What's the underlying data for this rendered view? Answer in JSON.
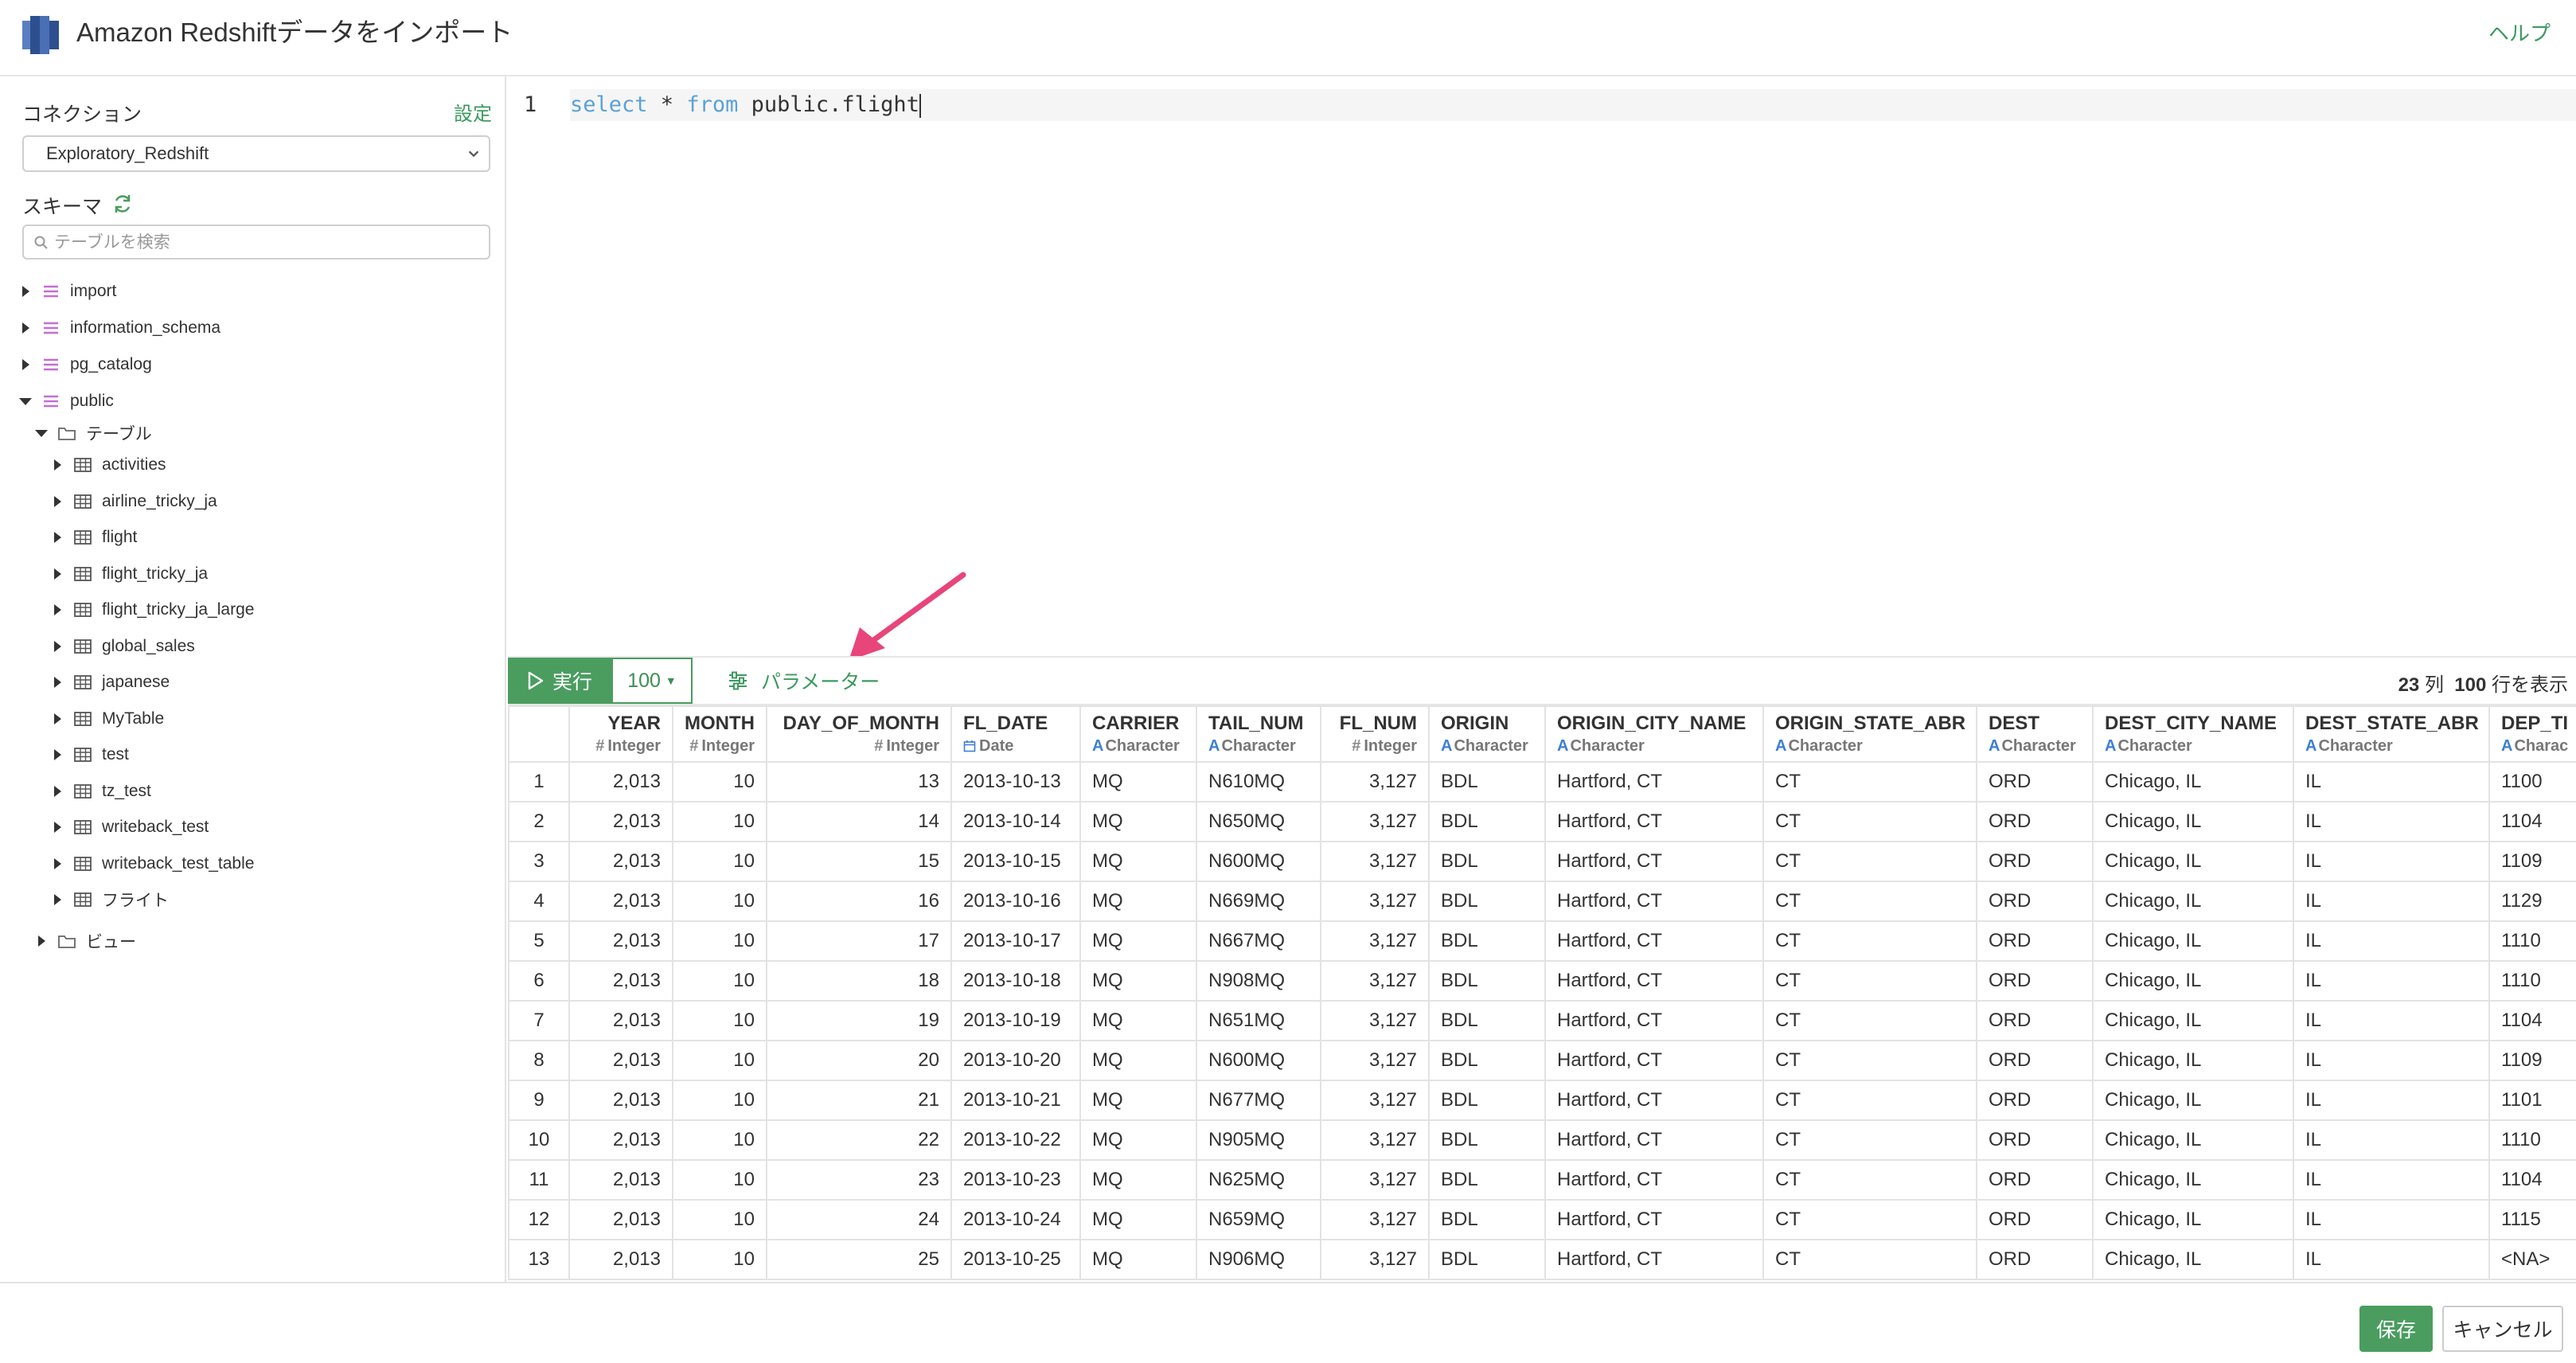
{
  "app": {
    "title": "Amazon Redshiftデータをインポート",
    "help_label": "ヘルプ"
  },
  "sidebar": {
    "connection_label": "コネクション",
    "settings_label": "設定",
    "connection_value": "Exploratory_Redshift",
    "schema_label": "スキーマ",
    "search_placeholder": "テーブルを検索",
    "schemas": [
      {
        "name": "import",
        "expanded": false
      },
      {
        "name": "information_schema",
        "expanded": false
      },
      {
        "name": "pg_catalog",
        "expanded": false
      },
      {
        "name": "public",
        "expanded": true
      }
    ],
    "tables_folder": "テーブル",
    "tables": [
      "activities",
      "airline_tricky_ja",
      "flight",
      "flight_tricky_ja",
      "flight_tricky_ja_large",
      "global_sales",
      "japanese",
      "MyTable",
      "test",
      "tz_test",
      "writeback_test",
      "writeback_test_table",
      "フライト"
    ],
    "views_folder": "ビュー"
  },
  "editor": {
    "line_number": "1",
    "tokens": [
      {
        "text": "select",
        "type": "kw"
      },
      {
        "text": " * ",
        "type": "plain"
      },
      {
        "text": "from",
        "type": "kw"
      },
      {
        "text": " public.flight",
        "type": "plain"
      }
    ]
  },
  "toolbar": {
    "run_label": "実行",
    "limit_value": "100",
    "params_label": "パラメーター",
    "col_count": "23",
    "col_suffix": "列",
    "row_count": "100",
    "row_suffix": "行を表示"
  },
  "table": {
    "columns": [
      {
        "name": "YEAR",
        "type": "Integer",
        "kind": "num",
        "align": "right"
      },
      {
        "name": "MONTH",
        "type": "Integer",
        "kind": "num",
        "align": "right"
      },
      {
        "name": "DAY_OF_MONTH",
        "type": "Integer",
        "kind": "num",
        "align": "right"
      },
      {
        "name": "FL_DATE",
        "type": "Date",
        "kind": "date",
        "align": "left"
      },
      {
        "name": "CARRIER",
        "type": "Character",
        "kind": "char",
        "align": "left"
      },
      {
        "name": "TAIL_NUM",
        "type": "Character",
        "kind": "char",
        "align": "left"
      },
      {
        "name": "FL_NUM",
        "type": "Integer",
        "kind": "num",
        "align": "right"
      },
      {
        "name": "ORIGIN",
        "type": "Character",
        "kind": "char",
        "align": "left"
      },
      {
        "name": "ORIGIN_CITY_NAME",
        "type": "Character",
        "kind": "char",
        "align": "left"
      },
      {
        "name": "ORIGIN_STATE_ABR",
        "type": "Character",
        "kind": "char",
        "align": "left"
      },
      {
        "name": "DEST",
        "type": "Character",
        "kind": "char",
        "align": "left"
      },
      {
        "name": "DEST_CITY_NAME",
        "type": "Character",
        "kind": "char",
        "align": "left"
      },
      {
        "name": "DEST_STATE_ABR",
        "type": "Character",
        "kind": "char",
        "align": "left"
      },
      {
        "name": "DEP_TI",
        "type": "Charac",
        "kind": "char",
        "align": "left"
      }
    ],
    "rows": [
      [
        "1",
        "2,013",
        "10",
        "13",
        "2013-10-13",
        "MQ",
        "N610MQ",
        "3,127",
        "BDL",
        "Hartford, CT",
        "CT",
        "ORD",
        "Chicago, IL",
        "IL",
        "1100"
      ],
      [
        "2",
        "2,013",
        "10",
        "14",
        "2013-10-14",
        "MQ",
        "N650MQ",
        "3,127",
        "BDL",
        "Hartford, CT",
        "CT",
        "ORD",
        "Chicago, IL",
        "IL",
        "1104"
      ],
      [
        "3",
        "2,013",
        "10",
        "15",
        "2013-10-15",
        "MQ",
        "N600MQ",
        "3,127",
        "BDL",
        "Hartford, CT",
        "CT",
        "ORD",
        "Chicago, IL",
        "IL",
        "1109"
      ],
      [
        "4",
        "2,013",
        "10",
        "16",
        "2013-10-16",
        "MQ",
        "N669MQ",
        "3,127",
        "BDL",
        "Hartford, CT",
        "CT",
        "ORD",
        "Chicago, IL",
        "IL",
        "1129"
      ],
      [
        "5",
        "2,013",
        "10",
        "17",
        "2013-10-17",
        "MQ",
        "N667MQ",
        "3,127",
        "BDL",
        "Hartford, CT",
        "CT",
        "ORD",
        "Chicago, IL",
        "IL",
        "1110"
      ],
      [
        "6",
        "2,013",
        "10",
        "18",
        "2013-10-18",
        "MQ",
        "N908MQ",
        "3,127",
        "BDL",
        "Hartford, CT",
        "CT",
        "ORD",
        "Chicago, IL",
        "IL",
        "1110"
      ],
      [
        "7",
        "2,013",
        "10",
        "19",
        "2013-10-19",
        "MQ",
        "N651MQ",
        "3,127",
        "BDL",
        "Hartford, CT",
        "CT",
        "ORD",
        "Chicago, IL",
        "IL",
        "1104"
      ],
      [
        "8",
        "2,013",
        "10",
        "20",
        "2013-10-20",
        "MQ",
        "N600MQ",
        "3,127",
        "BDL",
        "Hartford, CT",
        "CT",
        "ORD",
        "Chicago, IL",
        "IL",
        "1109"
      ],
      [
        "9",
        "2,013",
        "10",
        "21",
        "2013-10-21",
        "MQ",
        "N677MQ",
        "3,127",
        "BDL",
        "Hartford, CT",
        "CT",
        "ORD",
        "Chicago, IL",
        "IL",
        "1101"
      ],
      [
        "10",
        "2,013",
        "10",
        "22",
        "2013-10-22",
        "MQ",
        "N905MQ",
        "3,127",
        "BDL",
        "Hartford, CT",
        "CT",
        "ORD",
        "Chicago, IL",
        "IL",
        "1110"
      ],
      [
        "11",
        "2,013",
        "10",
        "23",
        "2013-10-23",
        "MQ",
        "N625MQ",
        "3,127",
        "BDL",
        "Hartford, CT",
        "CT",
        "ORD",
        "Chicago, IL",
        "IL",
        "1104"
      ],
      [
        "12",
        "2,013",
        "10",
        "24",
        "2013-10-24",
        "MQ",
        "N659MQ",
        "3,127",
        "BDL",
        "Hartford, CT",
        "CT",
        "ORD",
        "Chicago, IL",
        "IL",
        "1115"
      ],
      [
        "13",
        "2,013",
        "10",
        "25",
        "2013-10-25",
        "MQ",
        "N906MQ",
        "3,127",
        "BDL",
        "Hartford, CT",
        "CT",
        "ORD",
        "Chicago, IL",
        "IL",
        "<NA>"
      ]
    ]
  },
  "footer": {
    "save_label": "保存",
    "cancel_label": "キャンセル"
  },
  "colors": {
    "accent": "#4a9d5f",
    "link": "#3c9a5f",
    "keyword": "#5aa2d6",
    "schema_icon": "#c36ed3",
    "arrow": "#e8457a"
  }
}
